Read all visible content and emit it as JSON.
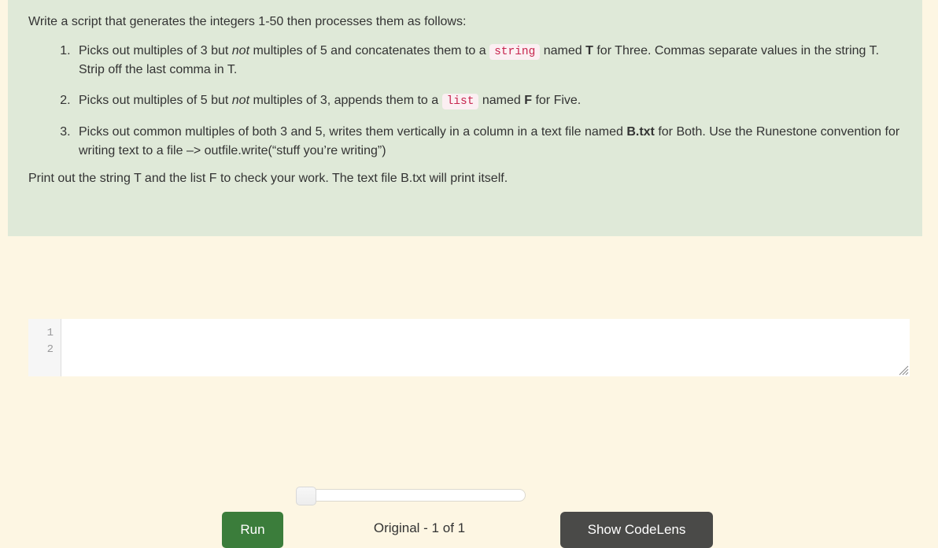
{
  "question": {
    "intro": "Write a script that generates the integers 1-50 then processes them as follows:",
    "items": [
      {
        "seg1": "Picks out multiples of 3 but ",
        "em1": "not",
        "seg2": " multiples of 5 and concatenates them to a ",
        "code": "string",
        "seg3": " named ",
        "bold": "T",
        "seg4": " for Three. Commas separate values in the string T. Strip off the last comma in T."
      },
      {
        "seg1": "Picks out multiples of 5 but ",
        "em1": "not",
        "seg2": " multiples of 3, appends them to a ",
        "code": "list",
        "seg3": " named ",
        "bold": "F",
        "seg4": " for Five."
      },
      {
        "seg1": "Picks out common multiples of both 3 and 5, writes them vertically in a column in a text file named ",
        "em1": "",
        "seg2": "",
        "code": "",
        "seg3": "",
        "bold": "B.txt",
        "seg4": " for Both. Use the Runestone convention for writing text to a file –> outfile.write(“stuff you’re writing”)"
      }
    ],
    "outro": "Print out the string T and the list F to check your work. The text file B.txt will print itself."
  },
  "controls": {
    "run_label": "Run",
    "version_label": "Original - 1 of 1",
    "codelens_label": "Show CodeLens",
    "slider_value": "0"
  },
  "editor": {
    "line_numbers": [
      "1",
      "2"
    ],
    "lines": [
      "",
      ""
    ]
  },
  "colors": {
    "question_panel_bg": "#dfe9d8",
    "page_bg": "#fdf6e3",
    "run_button_bg": "#3b7d3b",
    "codelens_button_bg": "#4a4a48",
    "inline_code_text": "#c7254e",
    "inline_code_bg": "#fbeff2"
  }
}
